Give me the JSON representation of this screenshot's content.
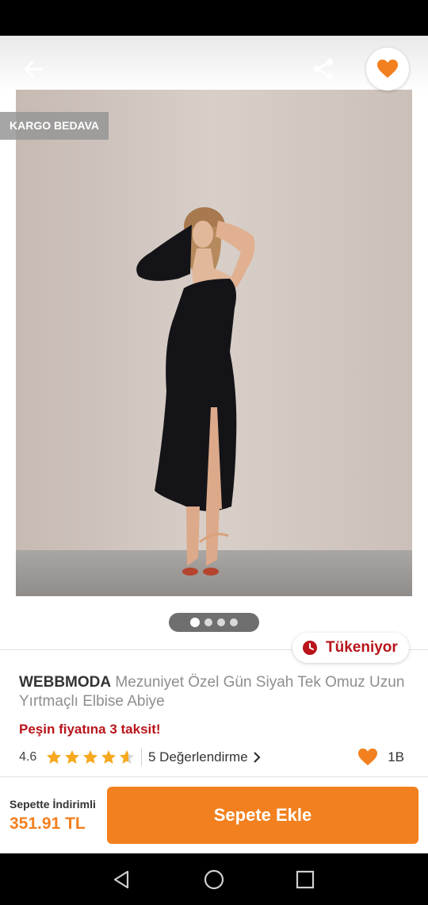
{
  "header": {
    "back_icon": "arrow-left-icon",
    "share_icon": "share-icon",
    "favorite_icon": "heart-icon"
  },
  "product": {
    "badge": "KARGO BEDAVA",
    "brand": "WEBBMODA",
    "name": " Mezuniyet Özel Gün Siyah Tek Omuz Uzun Yırtmaçlı Elbise Abiye",
    "stock_status": "Tükeniyor",
    "installment": "Peşin fiyatına 3 taksit!",
    "rating": "4.6",
    "rating_value": 4.6,
    "rating_max": 5,
    "reviews": "5 Değerlendirme",
    "likes": "1B"
  },
  "gallery": {
    "pages": 4,
    "active_page": 1
  },
  "cart": {
    "discount_label": "Sepette İndirimli",
    "price": "351.91 TL",
    "add_button": "Sepete Ekle"
  },
  "colors": {
    "accent": "#f2801f",
    "alert": "#b9141b"
  }
}
